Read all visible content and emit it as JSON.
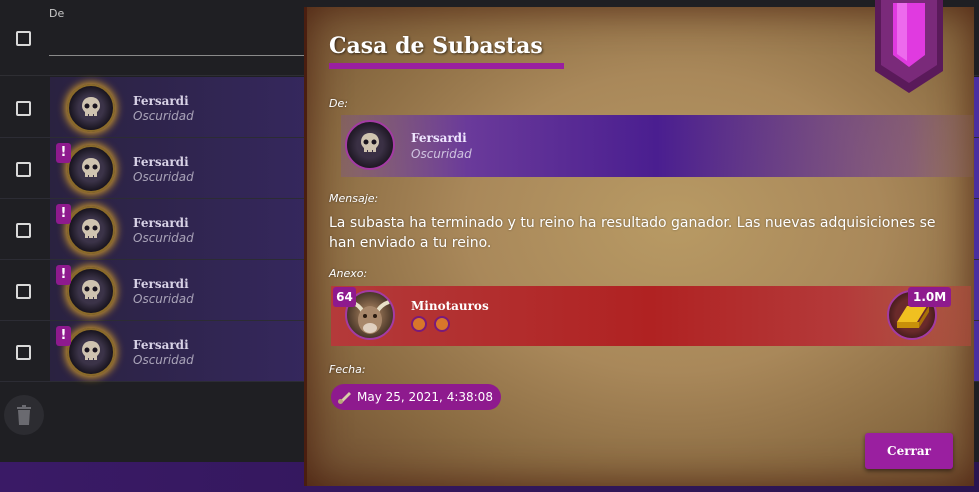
{
  "list": {
    "header_from": "De",
    "rows": [
      {
        "name": "Fersardi",
        "faction": "Oscuridad",
        "unread": false
      },
      {
        "name": "Fersardi",
        "faction": "Oscuridad",
        "unread": true
      },
      {
        "name": "Fersardi",
        "faction": "Oscuridad",
        "unread": true
      },
      {
        "name": "Fersardi",
        "faction": "Oscuridad",
        "unread": true
      },
      {
        "name": "Fersardi",
        "faction": "Oscuridad",
        "unread": true
      }
    ],
    "unread_marker": "!"
  },
  "modal": {
    "title": "Casa de Subastas",
    "from_label": "De:",
    "from": {
      "name": "Fersardi",
      "faction": "Oscuridad"
    },
    "message_label": "Mensaje:",
    "message": "La subasta ha terminado y tu reino ha resultado ganador. Las nuevas adquisiciones se han enviado a tu reino.",
    "attachment_label": "Anexo:",
    "attachment": {
      "level": "64",
      "name": "Minotauros",
      "gold": "1.0M"
    },
    "date_label": "Fecha:",
    "date": "May 25, 2021, 4:38:08",
    "close_label": "Cerrar"
  },
  "colors": {
    "accent": "#9a1fa0",
    "badge": "#8e1a8e",
    "attachment": "#b02222",
    "sender": "#4a1e90"
  }
}
